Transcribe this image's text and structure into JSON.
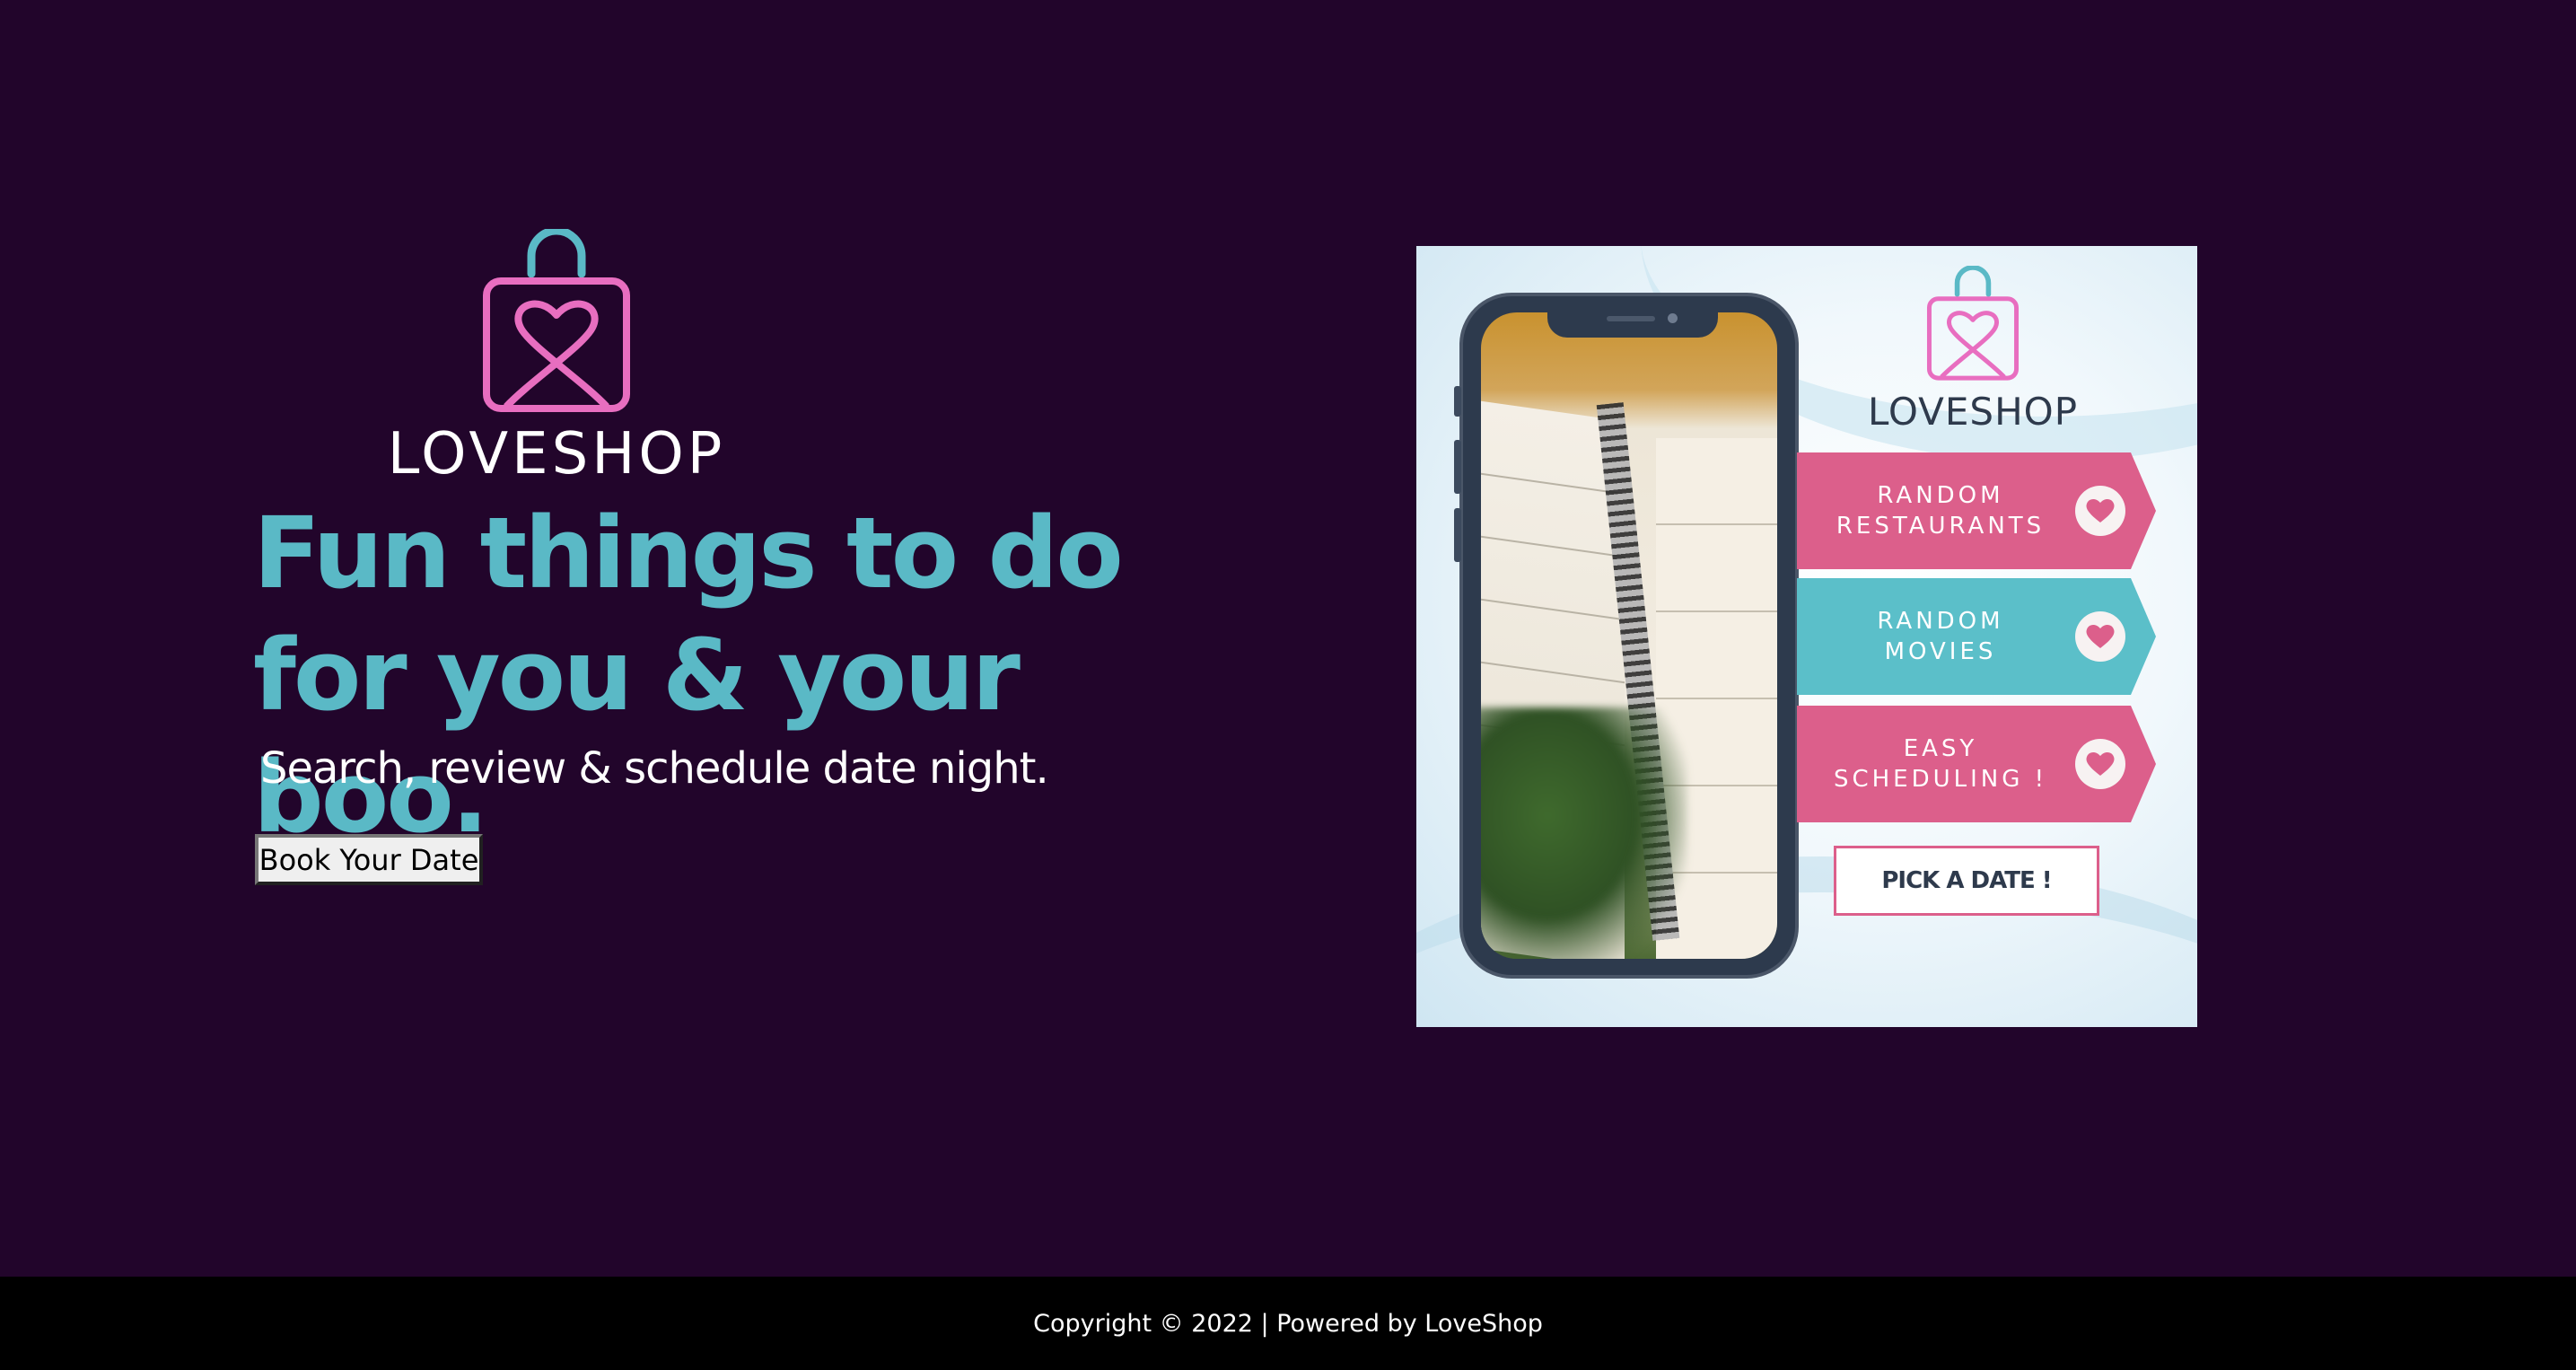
{
  "hero": {
    "logo_text": "LOVESHOP",
    "headline_line1": "Fun things to do",
    "headline_line2": "for you & your boo.",
    "subheadline": "Search, review & schedule date night.",
    "cta_label": "Book Your Date"
  },
  "promo": {
    "logo_text": "LOVESHOP",
    "ribbons": [
      {
        "label": "RANDOM\nRESTAURANTS",
        "color": "#dc5f8b"
      },
      {
        "label": "RANDOM\nMOVIES",
        "color": "#5bbfc9"
      },
      {
        "label": "EASY\nSCHEDULING !",
        "color": "#dc5f8b"
      }
    ],
    "pick_label": "PICK A DATE !"
  },
  "footer": {
    "text": "Copyright © 2022 | Powered by LoveShop"
  },
  "colors": {
    "background": "#22052b",
    "accent_teal": "#5ab9c6",
    "accent_pink": "#e86ec0",
    "footer": "#000000"
  },
  "icons": [
    "shopping-bag-heart-logo-icon",
    "heart-icon"
  ]
}
